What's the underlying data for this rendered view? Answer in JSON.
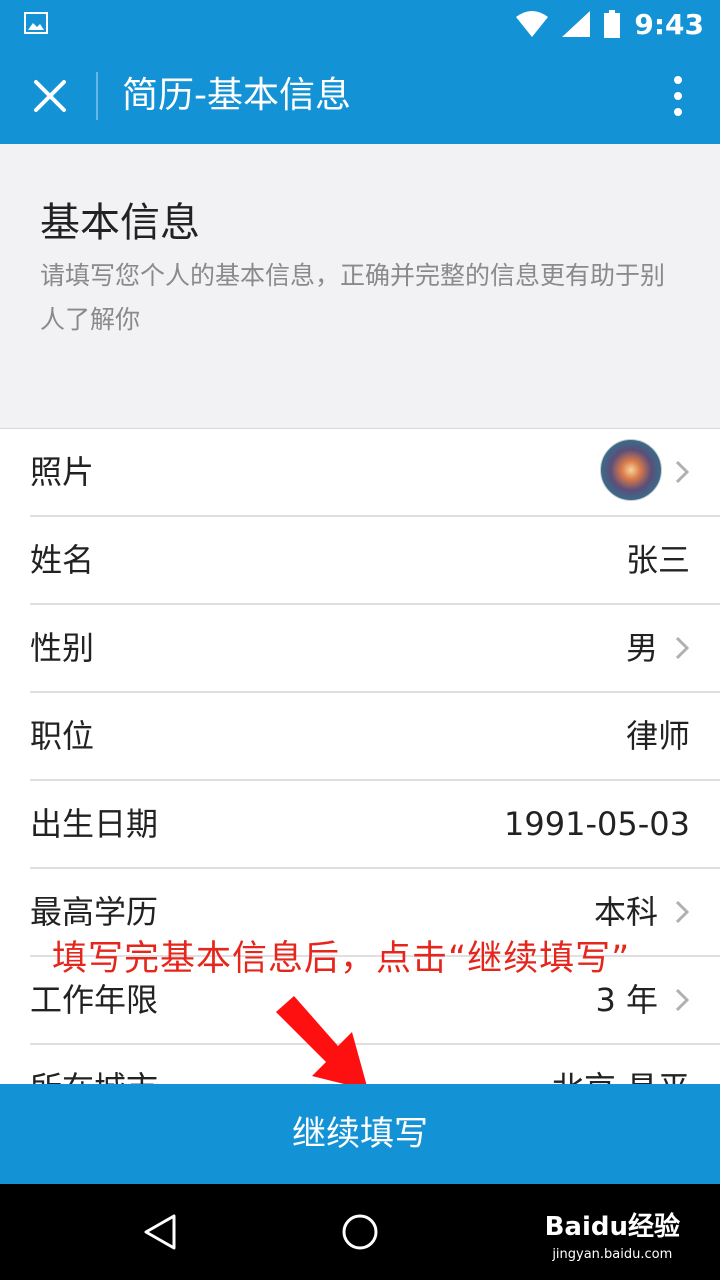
{
  "status_bar": {
    "time": "9:43"
  },
  "app_bar": {
    "title": "简历-基本信息"
  },
  "intro": {
    "heading": "基本信息",
    "description": "请填写您个人的基本信息，正确并完整的信息更有助于别人了解你"
  },
  "fields": [
    {
      "label": "照片",
      "value": "",
      "has_chevron": true
    },
    {
      "label": "姓名",
      "value": "张三",
      "has_chevron": false
    },
    {
      "label": "性别",
      "value": "男",
      "has_chevron": true
    },
    {
      "label": "职位",
      "value": "律师",
      "has_chevron": false
    },
    {
      "label": "出生日期",
      "value": "1991-05-03",
      "has_chevron": false
    },
    {
      "label": "最高学历",
      "value": "本科",
      "has_chevron": true
    },
    {
      "label": "工作年限",
      "value": "3 年",
      "has_chevron": true
    },
    {
      "label": "所在城市",
      "value": "北京 昌平",
      "has_chevron": false
    }
  ],
  "annotation": {
    "text": "填写完基本信息后，点击“继续填写”"
  },
  "continue_button": {
    "label": "继续填写"
  },
  "watermark": {
    "brand": "Baidu经验",
    "url": "jingyan.baidu.com"
  },
  "colors": {
    "primary": "#1492d6",
    "annotation": "#e5261d"
  },
  "icons": [
    "image-icon",
    "wifi-icon",
    "cell-signal-icon",
    "battery-icon",
    "close-icon",
    "more-vert-icon",
    "chevron-right-icon",
    "back-icon",
    "home-icon",
    "arrow-icon"
  ]
}
